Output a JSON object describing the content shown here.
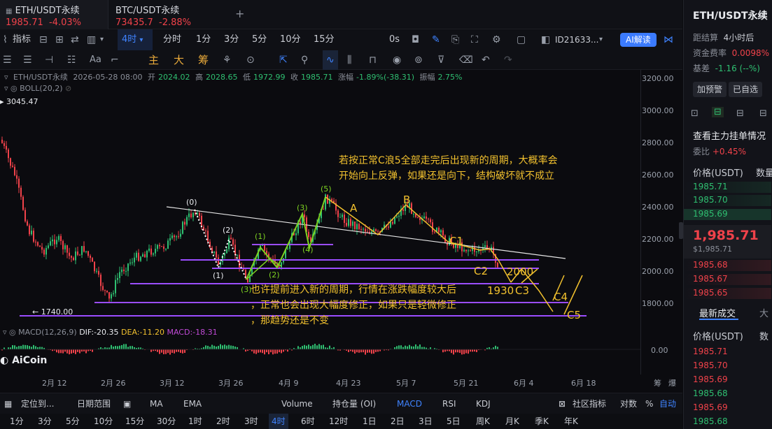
{
  "tabs": [
    {
      "name": "ETH/USDT永续",
      "price": "1985.71",
      "change": "-4.03%"
    },
    {
      "name": "BTC/USDT永续",
      "price": "73435.7",
      "change": "-2.88%"
    }
  ],
  "tab_add": "+",
  "tab_close": "x",
  "toolbar": {
    "indicators": "指标",
    "interval": "4时",
    "intervals": [
      "分时",
      "1分",
      "3分",
      "5分",
      "10分",
      "15分"
    ],
    "sec": "0s",
    "user_id": "ID21633...",
    "ai_btn": "AI解读"
  },
  "drawbar": {
    "text_tool": "Aa",
    "zhu": "主",
    "da": "大",
    "chou": "筹"
  },
  "chart": {
    "symbol": "ETH/USDT永续",
    "datetime": "2026-05-28 08:00",
    "open_label": "开",
    "open": "2024.02",
    "high_label": "高",
    "high": "2028.65",
    "low_label": "低",
    "low": "1972.99",
    "close_label": "收",
    "close": "1985.71",
    "change_label": "涨幅",
    "change": "-1.89%(-38.31)",
    "amp_label": "振幅",
    "amp": "2.75%",
    "boll": "BOLL(20,2)",
    "max_label": "3045.47",
    "min_label": "← 1740.00",
    "macd_name": "MACD(12,26,9)",
    "dif": "DIF:-20.35",
    "dea": "DEA:-11.20",
    "macd": "MACD:-18.31",
    "logo": "AiCoin",
    "y_ticks": [
      "3200.00",
      "3000.00",
      "2800.00",
      "2600.00",
      "2400.00",
      "2200.00",
      "2000.00",
      "1800.00"
    ],
    "macd_zero": "0.00",
    "x_ticks": [
      "2月 12",
      "2月 26",
      "3月 12",
      "3月 26",
      "4月 9",
      "4月 23",
      "5月 7",
      "5月 21",
      "6月 4",
      "6月 18"
    ],
    "axis_right": [
      "筹",
      "爆"
    ]
  },
  "annotations": {
    "top_note_1": "若按正常C浪5全部走完后出现新的周期，大概率会",
    "top_note_2": "开始向上反弹，如果还是向下，结构破坏就不成立",
    "bottom_note_1": "也许提前进入新的周期，行情在涨跌幅度较大后",
    "bottom_note_2": "，正常也会出现大幅度修正，如果只是轻微修正",
    "bottom_note_3": "，那趋势还是不变",
    "wave_0": "(0)",
    "wave_1": "(1)",
    "wave_2": "(2)",
    "wave_3": "(3)",
    "wave_4": "(4)",
    "wave_5": "(5)",
    "wave_1b": "(1)",
    "wave_2b": "(2)",
    "wave_3b": "(3)",
    "A": "A",
    "B": "B",
    "C1": "C1",
    "C2": "C2",
    "C3": "C3",
    "C4": "C4",
    "C5": "C5",
    "lvl_2000": "2000",
    "lvl_1930": "1930"
  },
  "indicator_bar": {
    "locate": "定位到...",
    "date_range": "日期范围",
    "items": [
      "MA",
      "EMA",
      "Volume",
      "持仓量 (OI)",
      "MACD",
      "RSI",
      "KDJ"
    ],
    "community": "社区指标",
    "log": "对数",
    "pct": "%",
    "auto": "自动"
  },
  "timeframes": [
    "1日",
    "1分",
    "3分",
    "5分",
    "10分",
    "15分",
    "30分",
    "1时",
    "2时",
    "3时",
    "4时",
    "6时",
    "12时",
    "1日",
    "2日",
    "3日",
    "5日",
    "周K",
    "月K",
    "季K",
    "年K"
  ],
  "right_panel": {
    "title": "ETH/USDT永续",
    "settle_label": "距结算",
    "settle_value": "4小时后",
    "funding_label": "资金费率",
    "funding_value": "0.0098%",
    "basis_label": "基差",
    "basis_value": "-1.16 (--%)",
    "alert_btn": "加预警",
    "fav_btn": "已自选",
    "book_title": "查看主力挂单情况",
    "ratio_label": "委比",
    "ratio_value": "+0.45%",
    "price_header": "价格(USDT)",
    "qty_header": "数量",
    "asks": [
      "1985.71",
      "1985.70",
      "1985.69"
    ],
    "last_price": "1,985.71",
    "last_price_sub": "$1,985.71",
    "bids": [
      "1985.68",
      "1985.67",
      "1985.65"
    ],
    "trades_title": "最新成交",
    "trades_tab2": "大",
    "trades_price_header": "价格(USDT)",
    "trades_qty_header": "数",
    "trades": [
      {
        "p": "1985.71",
        "c": "red"
      },
      {
        "p": "1985.70",
        "c": "red"
      },
      {
        "p": "1985.69",
        "c": "red"
      },
      {
        "p": "1985.68",
        "c": "green"
      },
      {
        "p": "1985.69",
        "c": "red"
      },
      {
        "p": "1985.68",
        "c": "green"
      }
    ]
  },
  "colors": {
    "accent": "#3f83ff",
    "up": "#2fbf71",
    "down": "#f0424a",
    "annotation": "#f2c12e",
    "level_line": "#9b4dff",
    "wave_green": "#7ed321"
  }
}
